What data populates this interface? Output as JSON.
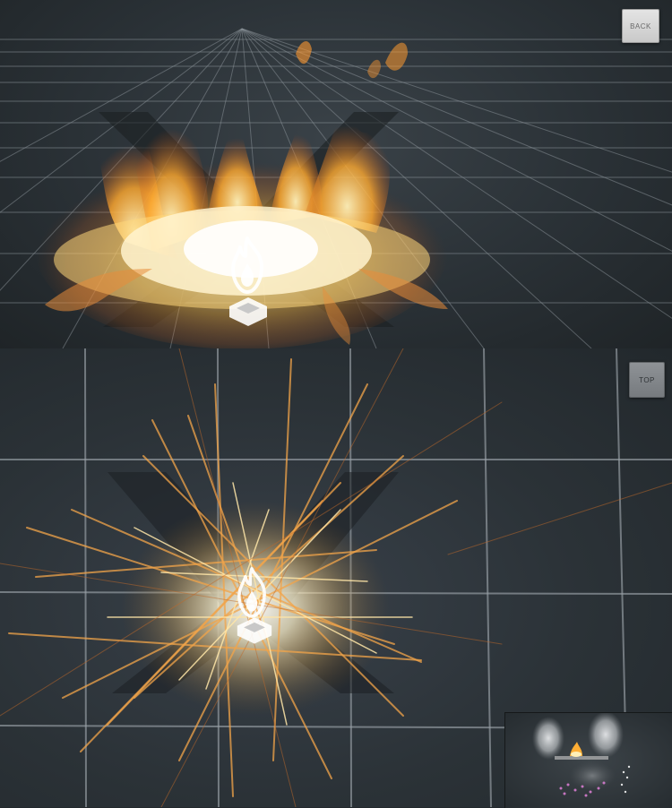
{
  "viewports": {
    "back": {
      "gizmo_label": "BACK"
    },
    "top": {
      "gizmo_label": "TOP"
    }
  },
  "icons": {
    "effect": "fire-emitter-icon",
    "emitter_base": "emitter-base-icon"
  },
  "colors": {
    "background": "#23292d",
    "grid_line": "#9aa2a8",
    "fire_core": "#fff6d8",
    "fire_mid": "#ffb43a",
    "fire_edge": "#d8661e",
    "gizmo_back": "#d9d9d9",
    "gizmo_top": "#84888c"
  }
}
